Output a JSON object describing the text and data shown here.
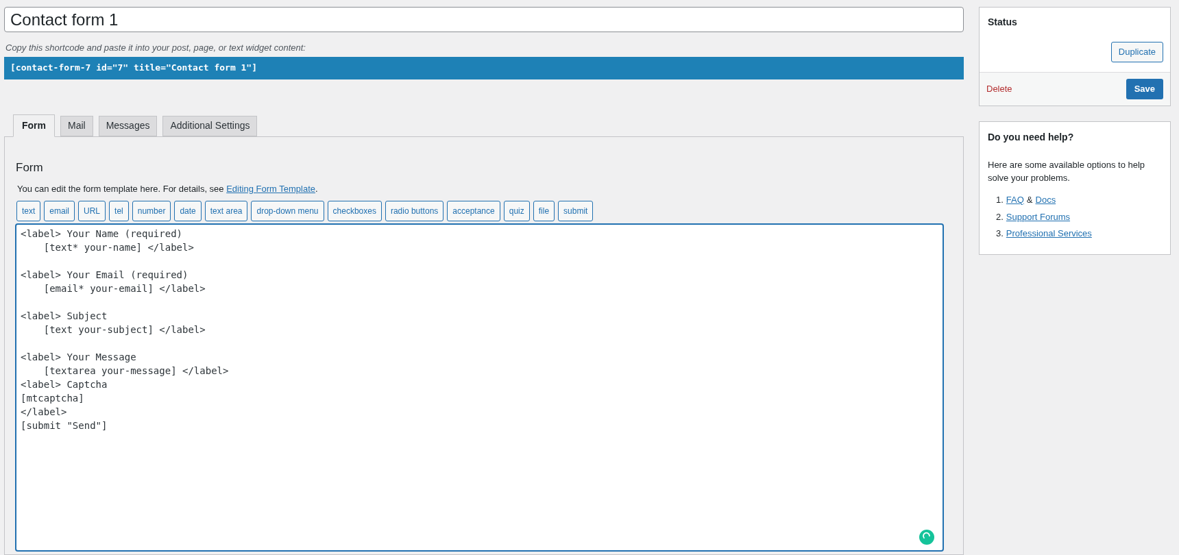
{
  "title_field": {
    "value": "Contact form 1"
  },
  "shortcode": {
    "caption": "Copy this shortcode and paste it into your post, page, or text widget content:",
    "code": "[contact-form-7 id=\"7\" title=\"Contact form 1\"]"
  },
  "tabs": [
    {
      "label": "Form",
      "selected": true
    },
    {
      "label": "Mail",
      "selected": false
    },
    {
      "label": "Messages",
      "selected": false
    },
    {
      "label": "Additional Settings",
      "selected": false
    }
  ],
  "form_panel": {
    "heading": "Form",
    "intro": "You can edit the form template here. For details, see ",
    "intro_link": "Editing Form Template",
    "intro_end": ".",
    "tag_buttons": [
      "text",
      "email",
      "URL",
      "tel",
      "number",
      "date",
      "text area",
      "drop-down menu",
      "checkboxes",
      "radio buttons",
      "acceptance",
      "quiz",
      "file",
      "submit"
    ],
    "template": "<label> Your Name (required)\n    [text* your-name] </label>\n\n<label> Your Email (required)\n    [email* your-email] </label>\n\n<label> Subject\n    [text your-subject] </label>\n\n<label> Your Message\n    [textarea your-message] </label>\n<label> Captcha\n[mtcaptcha]\n</label>\n[submit \"Send\"]"
  },
  "status_box": {
    "title": "Status",
    "duplicate": "Duplicate",
    "delete": "Delete",
    "save": "Save"
  },
  "help_box": {
    "title": "Do you need help?",
    "text": "Here are some available options to help solve your problems.",
    "items": [
      {
        "number": "1.",
        "links": [
          "FAQ",
          "Docs"
        ],
        "joiner": "&"
      },
      {
        "number": "2.",
        "links": [
          "Support Forums"
        ]
      },
      {
        "number": "3.",
        "links": [
          "Professional Services"
        ]
      }
    ]
  }
}
